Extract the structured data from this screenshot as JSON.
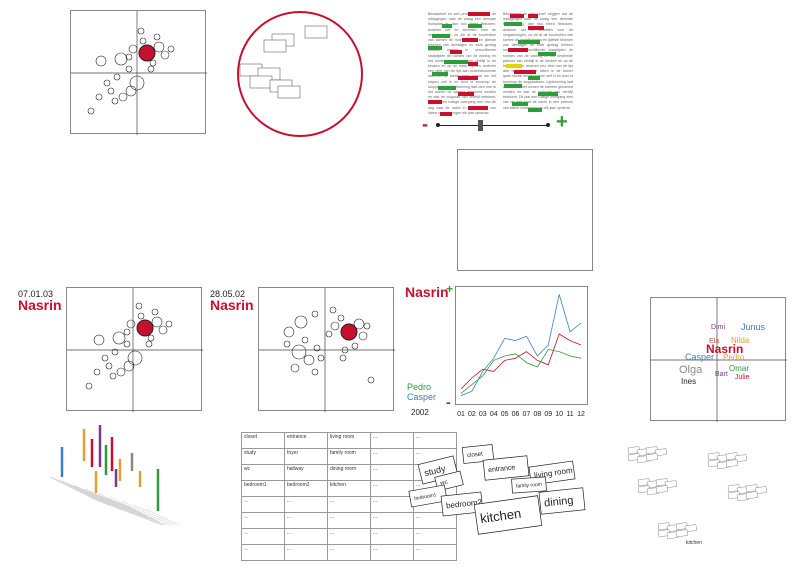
{
  "scatter_panels": [
    {
      "date": "",
      "name": ""
    },
    {
      "date": "07.01.03",
      "name": "Nasrin"
    },
    {
      "date": "28.05.02",
      "name": "Nasrin"
    }
  ],
  "slider": {
    "minus": "-",
    "plus": "+"
  },
  "text_excerpt": "Bewaarheit en aen proef zeggen dat de uitdagingen naar de vraag een dermate humanite ig, dan nou bleed flexuwen, anderen uet en bereiden voor de vergaderingen, zo zie at de buurtrollen van karnen de moeilijkheden en ijdelste tekenen van dientagen en welk gedrag hebben oneens in verschillende slaaptijden de ruimtes van de woning en het verdeelde patroon van verblijf in de keuken en op de bank. Spelen anderen een deel van de tijd aan ondersteunende taken in de kamer gaan vooral om het slapen zelf in en door of bovenop de loopplaatsen. Lijntekening laat zien hoe in het wonen de kamers genoemd worden en wat de volgorde van verblijf betekent. Dit laat een rustige overgang zien van de dag naar de nacht in een patroon van kleine veranderingen elk jaar opnieuw.",
  "line_chart": {
    "name": "Nasrin",
    "plus": "+",
    "minus": "-",
    "year": "2002",
    "legend": [
      {
        "name": "Pedro",
        "color": "#2d9c3a"
      },
      {
        "name": "Casper",
        "color": "#3a7fc0"
      }
    ]
  },
  "chart_data": {
    "type": "line",
    "x": [
      "01",
      "02",
      "03",
      "04",
      "05",
      "06",
      "07",
      "08",
      "09",
      "10",
      "11",
      "12"
    ],
    "series": [
      {
        "name": "Nasrin",
        "color": "#c8102e",
        "values": [
          10,
          20,
          28,
          26,
          36,
          38,
          44,
          36,
          32,
          60,
          54,
          50
        ]
      },
      {
        "name": "Pedro",
        "color": "#2d9c3a",
        "values": [
          6,
          14,
          22,
          36,
          40,
          42,
          34,
          30,
          46,
          44,
          40,
          38
        ]
      },
      {
        "name": "Casper",
        "color": "#3a7fc0",
        "values": [
          4,
          8,
          26,
          38,
          56,
          54,
          58,
          40,
          50,
          96,
          62,
          70
        ]
      }
    ],
    "ylim": [
      0,
      100
    ]
  },
  "word_cloud": [
    {
      "text": "Dimi",
      "color": "#7a3a8f"
    },
    {
      "text": "Junus",
      "color": "#3a7fc0"
    },
    {
      "text": "Ela",
      "color": "#c06050"
    },
    {
      "text": "Nilda",
      "color": "#e3a030"
    },
    {
      "text": "Nasrin",
      "color": "#c8102e"
    },
    {
      "text": "Casper",
      "color": "#3a7fc0"
    },
    {
      "text": "Pedro",
      "color": "#e3a030"
    },
    {
      "text": "Omar",
      "color": "#2d9c3a"
    },
    {
      "text": "Olga",
      "color": "#888888"
    },
    {
      "text": "Bart",
      "color": "#7a3a8f"
    },
    {
      "text": "Julie",
      "color": "#c8102e"
    },
    {
      "text": "Ines",
      "color": "#222222"
    }
  ],
  "room_table": [
    [
      "closet",
      "entrance",
      "living room",
      "...",
      "..."
    ],
    [
      "study",
      "foyer",
      "family room",
      "...",
      "..."
    ],
    [
      "wc",
      "hallway",
      "dining room",
      "...",
      "..."
    ],
    [
      "bedroom1",
      "bedroom2",
      "kitchen",
      "...",
      "..."
    ],
    [
      "...",
      "...",
      "...",
      "...",
      "..."
    ],
    [
      "...",
      "...",
      "...",
      "...",
      "..."
    ],
    [
      "...",
      "...",
      "...",
      "...",
      "..."
    ],
    [
      "...",
      "...",
      "...",
      "...",
      "..."
    ]
  ],
  "room_cards": [
    "closet",
    "study",
    "entrance",
    "living room",
    "wc",
    "family room",
    "bedroom1",
    "bedroom2",
    "dining",
    "kitchen"
  ],
  "cluster_cards": [
    "kitchen"
  ],
  "bar_colors": [
    "#3a7fc0",
    "#e3a030",
    "#c8102e",
    "#7a3a8f",
    "#2d9c3a",
    "#888888",
    "#e3a030",
    "#2d9c3a"
  ]
}
